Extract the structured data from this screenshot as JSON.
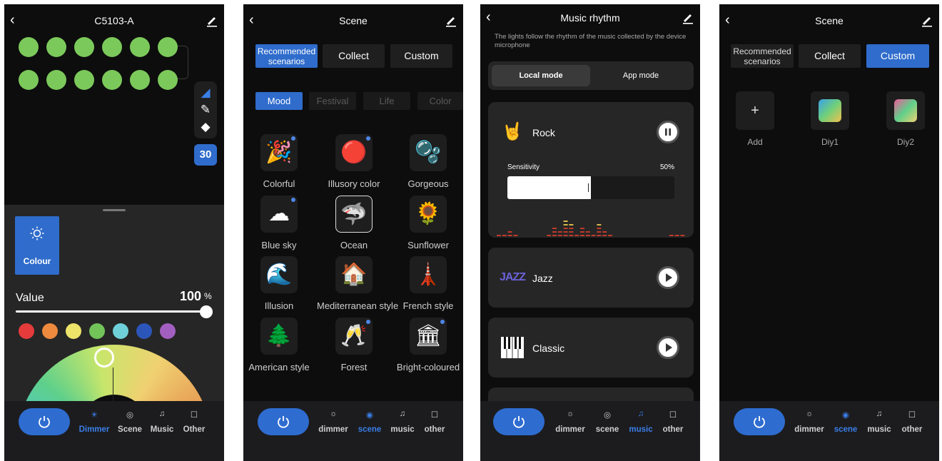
{
  "panel1": {
    "title": "C5103-A",
    "badge": "30",
    "colour_label": "Colour",
    "value_label": "Value",
    "value": "100",
    "value_unit": "%",
    "brightness_level": 1.0,
    "swatches": [
      "#e53b3b",
      "#ee8a3e",
      "#ede46a",
      "#72c459",
      "#6fd0da",
      "#2b55b8",
      "#a35fc0"
    ],
    "tabs": [
      "Dimmer",
      "Scene",
      "Music",
      "Other"
    ]
  },
  "panel2": {
    "title": "Scene",
    "segments": [
      "Recommended scenarios",
      "Collect",
      "Custom"
    ],
    "chips": [
      "Mood",
      "Festival",
      "Life",
      "Color"
    ],
    "scenes": [
      {
        "name": "Colorful",
        "icon": "🎉"
      },
      {
        "name": "Illusory color",
        "icon": "🔴"
      },
      {
        "name": "Gorgeous",
        "icon": "🫧"
      },
      {
        "name": "Blue sky",
        "icon": "☁"
      },
      {
        "name": "Ocean",
        "icon": "🦈"
      },
      {
        "name": "Sunflower",
        "icon": "🌻"
      },
      {
        "name": "Illusion",
        "icon": "🌊"
      },
      {
        "name": "Mediterranean style",
        "icon": "🏠"
      },
      {
        "name": "French style",
        "icon": "🗼"
      },
      {
        "name": "American style",
        "icon": "🌲"
      },
      {
        "name": "Forest",
        "icon": "🥂"
      },
      {
        "name": "Bright-coloured",
        "icon": "🏛"
      }
    ],
    "tabs": [
      "dimmer",
      "scene",
      "music",
      "other"
    ]
  },
  "panel3": {
    "title": "Music rhythm",
    "hint": "The lights follow the rhythm of the music collected by the device microphone",
    "modes": [
      "Local mode",
      "App mode"
    ],
    "rock": "Rock",
    "sensitivity_label": "Sensitivity",
    "sensitivity_value": "50%",
    "sensitivity": 0.5,
    "jazz": "Jazz",
    "jazz_icon": "JAZZ",
    "classic": "Classic",
    "tabs": [
      "dimmer",
      "scene",
      "music",
      "other"
    ]
  },
  "panel4": {
    "title": "Scene",
    "segments": [
      "Recommended scenarios",
      "Collect",
      "Custom"
    ],
    "items": [
      "Add",
      "Diy1",
      "Diy2"
    ],
    "tabs": [
      "dimmer",
      "scene",
      "music",
      "other"
    ]
  }
}
